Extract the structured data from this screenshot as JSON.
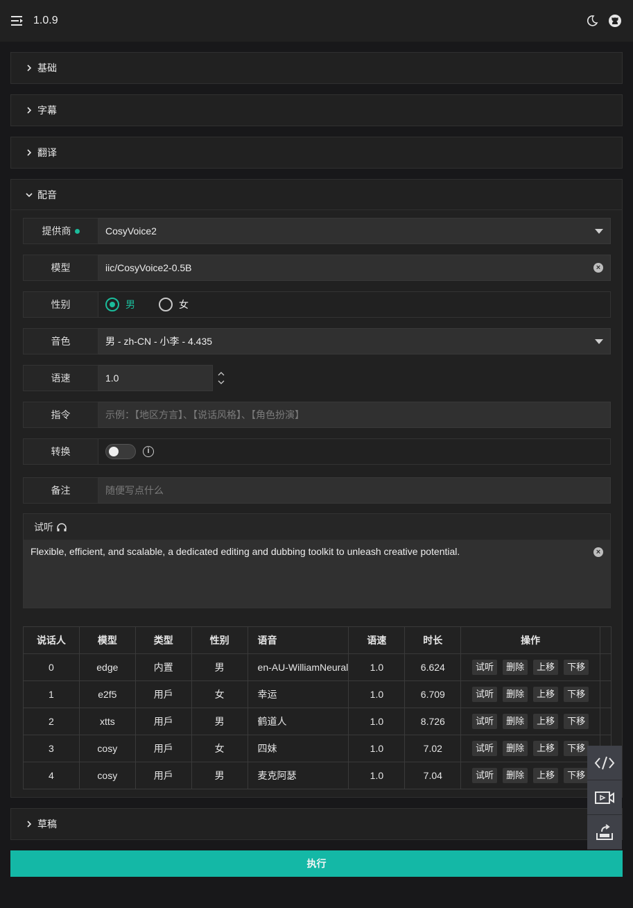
{
  "header": {
    "version": "1.0.9"
  },
  "sections": {
    "basic": "基础",
    "subtitle": "字幕",
    "translate": "翻译",
    "dubbing": "配音",
    "draft": "草稿"
  },
  "dubbing": {
    "provider": {
      "label": "提供商",
      "value": "CosyVoice2"
    },
    "model": {
      "label": "模型",
      "value": "iic/CosyVoice2-0.5B"
    },
    "gender": {
      "label": "性别",
      "male": "男",
      "female": "女",
      "selected": "男"
    },
    "voice": {
      "label": "音色",
      "value": "男 - zh-CN - 小李 - 4.435"
    },
    "speed": {
      "label": "语速",
      "value": "1.0"
    },
    "instruction": {
      "label": "指令",
      "placeholder": "示例：【地区方言】、【说话风格】、【角色扮演】"
    },
    "convert": {
      "label": "转换",
      "enabled": false
    },
    "note": {
      "label": "备注",
      "placeholder": "随便写点什么"
    },
    "preview": {
      "label": "试听",
      "text": "Flexible, efficient, and scalable, a dedicated editing and dubbing toolkit to unleash creative potential."
    }
  },
  "table": {
    "headers": [
      "说话人",
      "模型",
      "类型",
      "性别",
      "语音",
      "语速",
      "时长",
      "操作"
    ],
    "actions": [
      "试听",
      "删除",
      "上移",
      "下移"
    ],
    "rows": [
      [
        "0",
        "edge",
        "内置",
        "男",
        "en-AU-WilliamNeural",
        "1.0",
        "6.624"
      ],
      [
        "1",
        "e2f5",
        "用戶",
        "女",
        "幸运",
        "1.0",
        "6.709"
      ],
      [
        "2",
        "xtts",
        "用戶",
        "男",
        "鹤道人",
        "1.0",
        "8.726"
      ],
      [
        "3",
        "cosy",
        "用戶",
        "女",
        "四妹",
        "1.0",
        "7.02"
      ],
      [
        "4",
        "cosy",
        "用戶",
        "男",
        "麦克阿瑟",
        "1.0",
        "7.04"
      ]
    ]
  },
  "run_button": "执行",
  "colors": {
    "accent": "#1bbc9b",
    "run": "#14b8a6"
  },
  "icons": [
    "menu-icon",
    "moon-icon",
    "github-icon",
    "code-icon",
    "video-icon",
    "export-icon",
    "headphone-icon"
  ]
}
